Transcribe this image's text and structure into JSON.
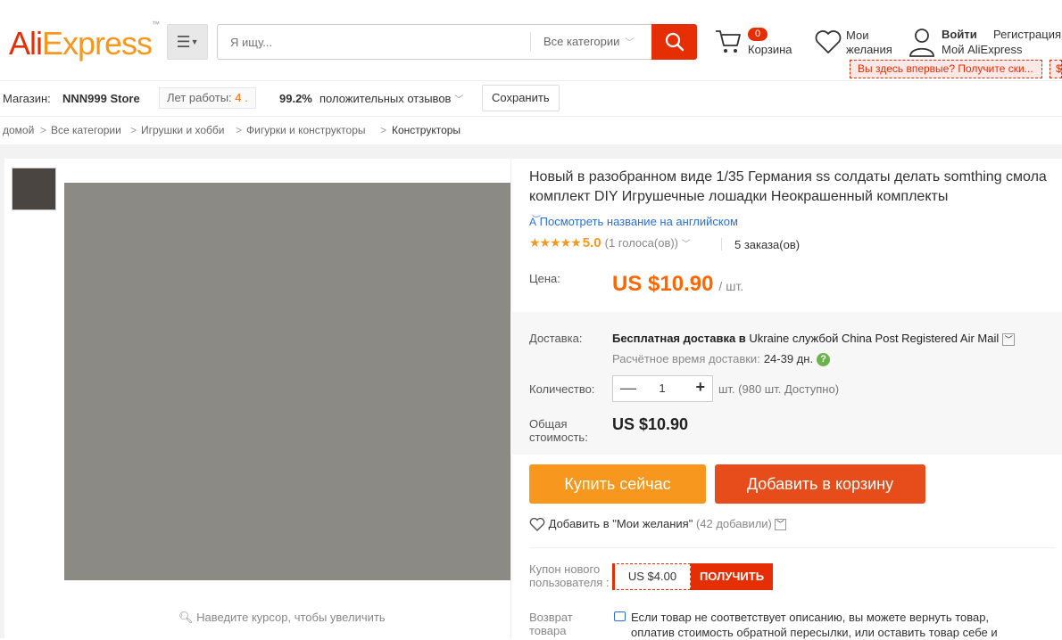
{
  "header": {
    "logo_a": "Ali",
    "logo_b": "Express",
    "logo_tm": "™",
    "search_placeholder": "Я ищу...",
    "search_category": "Все категории",
    "cart_count": "0",
    "cart_label": "Корзина",
    "wishlist_label": "Мои желания",
    "login": "Войти",
    "register": "Регистрация",
    "my_account": "Мой AliExpress",
    "promo": "Вы здесь впервые? Получите ски...",
    "promo_right": "$",
    "accent": "#e62e04"
  },
  "store": {
    "store_label": "Магазин:",
    "store_name": "NNN999 Store",
    "years_label": "Лет работы:",
    "years_value": "4",
    "years_dot": ".",
    "positive_pct": "99.2%",
    "positive_label": "положительных отзывов",
    "save_button": "Сохранить"
  },
  "breadcrumb": [
    "домой",
    "Все категории",
    "Игрушки и хобби",
    "Фигурки и конструкторы",
    "Конструкторы"
  ],
  "gallery": {
    "zoom_hint": "Наведите курсор, чтобы увеличить"
  },
  "product": {
    "title": "Новый в разобранном виде 1/35 Германия ss солдаты делать somthing смола комплект DIY Игрушечные лошадки Неокрашенный комплекты",
    "translate_link": "Посмотреть название на английском",
    "stars": "★★★★★",
    "score": "5.0",
    "votes": "(1 голоса(ов))",
    "orders": "5 заказа(ов)",
    "price_label": "Цена:",
    "price": "US $10.90",
    "price_unit": "/ шт.",
    "shipping_label": "Доставка:",
    "shipping_bold": "Бесплатная доставка в ",
    "shipping_country": "Ukraine",
    "shipping_via": " службой ",
    "shipping_carrier": "China Post Registered Air Mail",
    "eta_label": "Расчётное время доставки:",
    "eta_value": "24-39 дн.",
    "quantity_label": "Количество:",
    "quantity": "1",
    "available": "шт. (980 шт. Доступно)",
    "total_label": "Общая стоимость:",
    "total": "US $10.90",
    "buy_now": "Купить сейчас",
    "add_to_cart": "Добавить в корзину",
    "wishlist_add": "Добавить в \"Мои желания\"",
    "wishlist_count": "(42 добавили)",
    "coupon_label": "Купон нового пользователя :",
    "coupon_amount": "US $4.00",
    "coupon_get": "ПОЛУЧИТЬ",
    "return_label": "Возврат товара",
    "return_text": "Если товар не соответствует описанию, вы можете вернуть товар, оплатив стоимость обратной пересылки, или оставить товар себе и"
  }
}
